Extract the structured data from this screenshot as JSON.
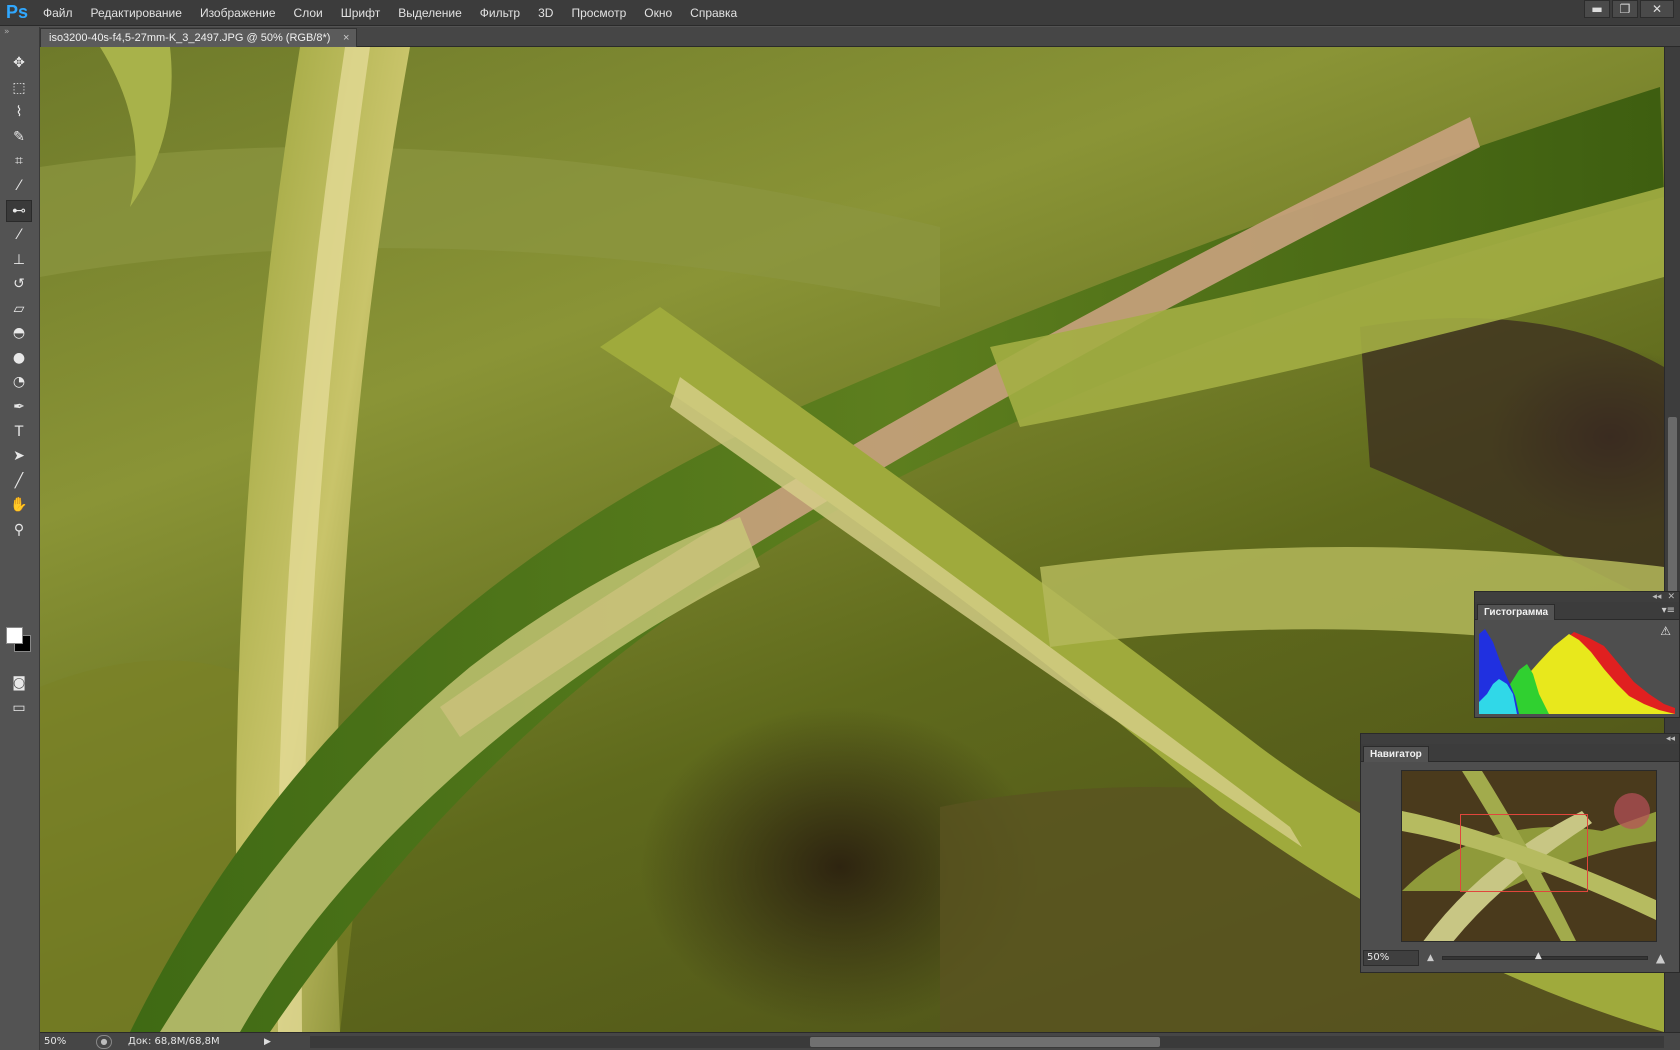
{
  "app": {
    "logo": "Ps",
    "menu": [
      "Файл",
      "Редактирование",
      "Изображение",
      "Слои",
      "Шрифт",
      "Выделение",
      "Фильтр",
      "3D",
      "Просмотр",
      "Окно",
      "Справка"
    ],
    "window_controls": {
      "minimize": "▬",
      "restore": "❐",
      "close": "✕"
    }
  },
  "document": {
    "tab_title": "iso3200-40s-f4,5-27mm-K_3_2497.JPG @ 50% (RGB/8*)",
    "tab_close": "×"
  },
  "toolbox": {
    "grip": "»",
    "tools": [
      {
        "name": "move-tool",
        "glyph": "✥"
      },
      {
        "name": "marquee-tool",
        "glyph": "⬚"
      },
      {
        "name": "lasso-tool",
        "glyph": "⌇"
      },
      {
        "name": "quick-select-tool",
        "glyph": "✎"
      },
      {
        "name": "crop-tool",
        "glyph": "⌗"
      },
      {
        "name": "eyedropper-tool",
        "glyph": "⁄"
      },
      {
        "name": "spot-healing-tool",
        "glyph": "⊷",
        "active": true
      },
      {
        "name": "brush-tool",
        "glyph": "⁄"
      },
      {
        "name": "clone-stamp-tool",
        "glyph": "⊥"
      },
      {
        "name": "history-brush-tool",
        "glyph": "↺"
      },
      {
        "name": "eraser-tool",
        "glyph": "▱"
      },
      {
        "name": "paint-bucket-tool",
        "glyph": "◓"
      },
      {
        "name": "blur-tool",
        "glyph": "●"
      },
      {
        "name": "dodge-tool",
        "glyph": "◔"
      },
      {
        "name": "pen-tool",
        "glyph": "✒"
      },
      {
        "name": "type-tool",
        "glyph": "T"
      },
      {
        "name": "path-selection-tool",
        "glyph": "➤"
      },
      {
        "name": "line-tool",
        "glyph": "╱"
      },
      {
        "name": "hand-tool",
        "glyph": "✋"
      },
      {
        "name": "zoom-tool",
        "glyph": "⚲"
      }
    ],
    "extra": [
      {
        "name": "quick-mask-tool",
        "glyph": "◙"
      },
      {
        "name": "screen-mode-tool",
        "glyph": "▭"
      }
    ],
    "foreground_color": "#ffffff",
    "background_color": "#000000"
  },
  "status": {
    "zoom": "50%",
    "doc_size": "Док: 68,8M/68,8M",
    "arrow": "▶"
  },
  "histogram_panel": {
    "tab": "Гистограмма",
    "warning": "⚠",
    "menu": "▾≡"
  },
  "navigator_panel": {
    "tab": "Навигатор",
    "zoom": "50%",
    "zoom_out": "▲",
    "zoom_in": "▲"
  }
}
